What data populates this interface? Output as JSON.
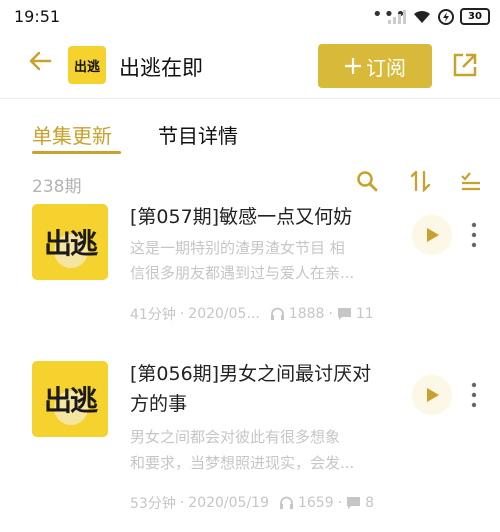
{
  "status": {
    "time": "19:51",
    "dots": "•••",
    "battery": "30"
  },
  "header": {
    "title": "出逃在即",
    "logo_text": "出逃",
    "subscribe_label": "订阅"
  },
  "tabs": {
    "active": "单集更新",
    "other": "节目详情"
  },
  "list": {
    "count": "238期"
  },
  "episodes": [
    {
      "cover_text": "出逃",
      "title": "[第057期]敏感一点又何妨",
      "desc_line1": "这是一期特别的渣男渣女节目 相",
      "desc_line2": "信很多朋友都遇到过与爱人在亲...",
      "duration": "41分钟",
      "date": "2020/05...",
      "plays": "1888",
      "comments": "11"
    },
    {
      "cover_text": "出逃",
      "title_line1": "[第056期]男女之间最讨厌对",
      "title_line2": "方的事",
      "desc_line1": "男女之间都会对彼此有很多想象",
      "desc_line2": "和要求，当梦想照进现实，会发...",
      "duration": "53分钟",
      "date": "2020/05/19",
      "plays": "1659",
      "comments": "8"
    }
  ],
  "colors": {
    "accent": "#c9a12d",
    "subscribe_bg": "#d9b93a",
    "cover_bg": "#f5d22d"
  }
}
